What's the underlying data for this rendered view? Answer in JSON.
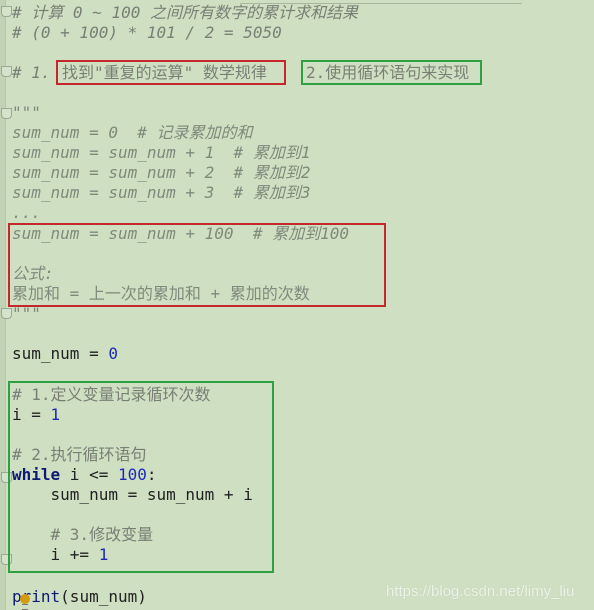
{
  "editor": {
    "lines": {
      "l1_hash": "#",
      "l1_text": " 计算 0 ~ 100 之间所有数字的累计求和结果",
      "l2": "# (0 + 100) * 101 / 2 = 5050",
      "l4_prefix": "# 1.",
      "l4_box1": "找到\"重复的运算\" 数学规律",
      "l4_box2": "2.使用循环语句来实现",
      "doc_open": "\"\"\"",
      "d1": "sum_num = 0  # 记录累加的和",
      "d2": "sum_num = sum_num + 1  # 累加到1",
      "d3": "sum_num = sum_num + 2  # 累加到2",
      "d4": "sum_num = sum_num + 3  # 累加到3",
      "d5": "...",
      "d6": "sum_num = sum_num + 100  # 累加到100",
      "d8": "公式:",
      "d9": "累加和 = 上一次的累加和 + 累加的次数",
      "doc_close": "\"\"\"",
      "c1_var": "sum_num = ",
      "c1_num": "0",
      "c2_comment": "# 1.定义变量记录循环次数",
      "c3_var": "i = ",
      "c3_num": "1",
      "c4_comment": "# 2.执行循环语句",
      "c5_kw": "while",
      "c5_mid": " i <= ",
      "c5_num": "100",
      "c5_end": ":",
      "c6": "    sum_num = sum_num + i",
      "c7_comment": "    # 3.修改变量",
      "c8_var": "    i += ",
      "c8_num": "1",
      "c9_fn": "print",
      "c9_args": "(sum_num)"
    }
  },
  "watermark": "https://blog.csdn.net/limy_liu",
  "colors": {
    "background": "#cfdfc2",
    "red_box": "#c5282c",
    "green_box": "#2ea043",
    "number": "#1d28b8",
    "keyword": "#0c1a74",
    "comment": "#7a7f76"
  }
}
